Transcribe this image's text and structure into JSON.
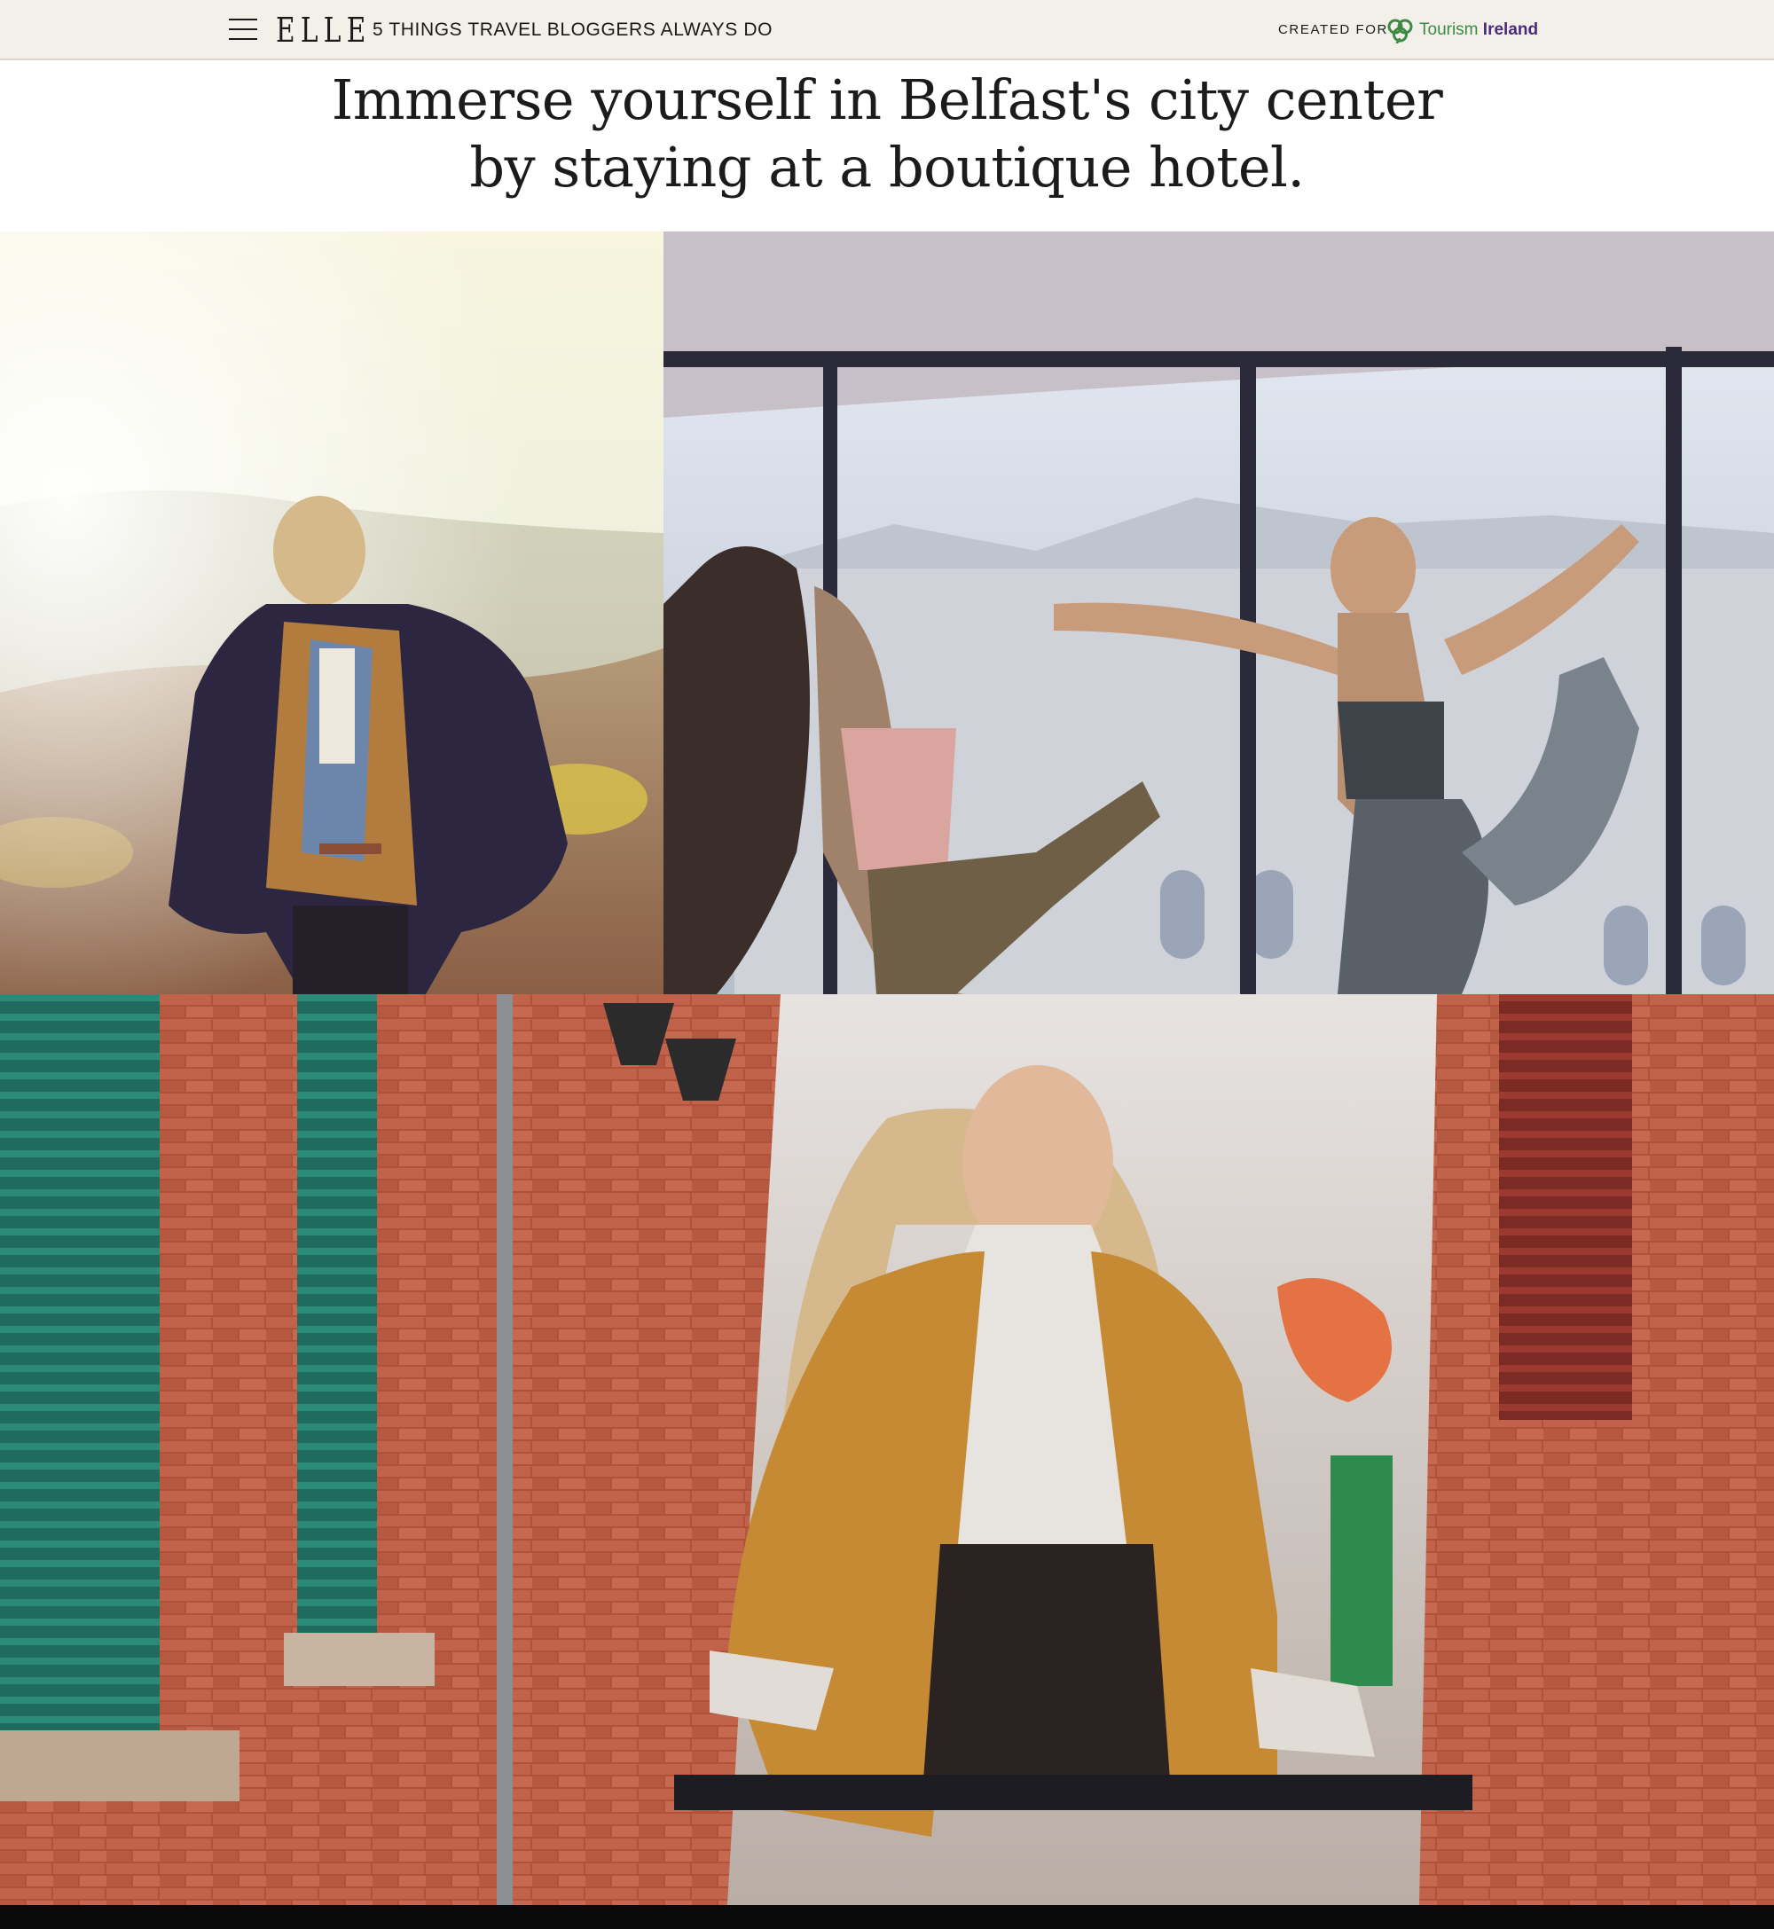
{
  "header": {
    "brand": "ELLE",
    "article_title": "5 THINGS TRAVEL BLOGGERS ALWAYS DO",
    "created_for_label": "CREATED FOR",
    "sponsor_name_light": "Tourism",
    "sponsor_name_bold": "Ireland"
  },
  "headline": {
    "line1": "Immerse yourself in Belfast's city center",
    "line2": "by staying at a boutique hotel."
  },
  "colors": {
    "topbar_bg": "#f3f0e9",
    "sponsor_green": "#3d8a45",
    "sponsor_purple": "#4a2a7a"
  },
  "icons": {
    "menu": "hamburger-menu-icon",
    "sponsor": "shamrock-icon"
  }
}
